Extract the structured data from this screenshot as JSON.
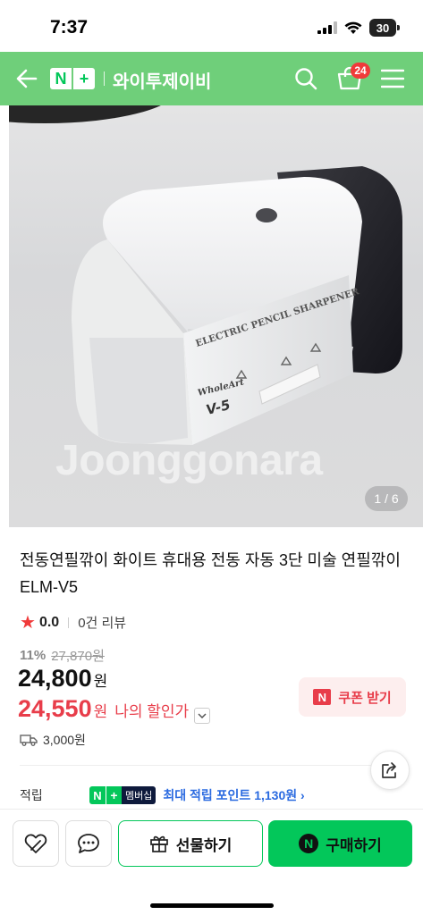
{
  "status_bar": {
    "time": "7:37",
    "battery": "30"
  },
  "header": {
    "store_name": "와이투제이비",
    "logo_n": "N",
    "logo_plus": "+",
    "cart_count": "24"
  },
  "product": {
    "image_counter": "1 / 6",
    "watermark": "Joonggonara",
    "title": "전동연필깎이 화이트 휴대용 전동 자동 3단 미술 연필깎이 ELM-V5",
    "rating": "0.0",
    "review_count": "0건 리뷰",
    "discount_pct": "11%",
    "original_price": "27,870원",
    "sale_price": "24,800",
    "my_price": "24,550",
    "currency": "원",
    "my_price_label": "나의 할인가",
    "coupon_label": "쿠폰 받기",
    "coupon_icon": "N",
    "shipping": "3,000원",
    "points_label": "적립",
    "points_badge_member": "멤버십",
    "points_text": "최대 적립 포인트 1,130원 ›"
  },
  "bottom_bar": {
    "gift_label": "선물하기",
    "buy_label": "구매하기",
    "buy_icon": "N"
  },
  "colors": {
    "header_green": "#6fcf7a",
    "naver_green": "#03c75a",
    "price_red": "#e83d4a",
    "points_blue": "#2a6ae0"
  }
}
